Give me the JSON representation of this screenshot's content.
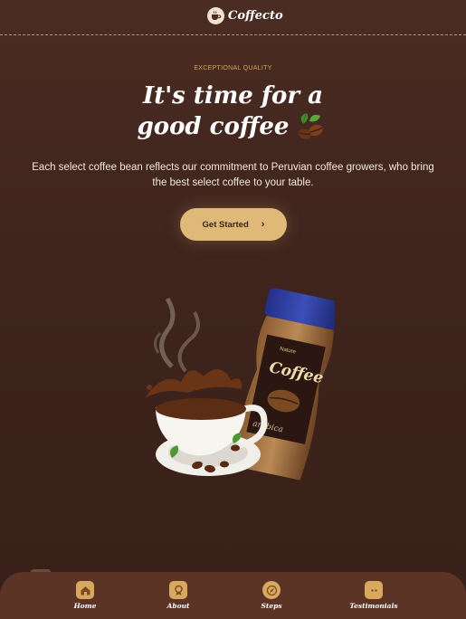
{
  "header": {
    "brand": "Coffecto",
    "logo_icon": "coffee-cup-icon"
  },
  "hero": {
    "eyebrow": "EXCEPTIONAL QUALITY",
    "headline_line1": "It's time for a",
    "headline_line2": "good coffee",
    "description": "Each select coffee bean reflects our commitment to Peruvian coffee growers, who bring the best select coffee to your table.",
    "cta_label": "Get Started",
    "cta_icon": "chevron-right-icon"
  },
  "product_jar": {
    "brand": "Nature",
    "name": "Coffee",
    "variant": "arabica"
  },
  "nav": {
    "items": [
      {
        "label": "Home",
        "icon": "home-icon"
      },
      {
        "label": "About",
        "icon": "award-icon"
      },
      {
        "label": "Steps",
        "icon": "compass-icon"
      },
      {
        "label": "Testimonials",
        "icon": "chat-icon"
      }
    ]
  },
  "colors": {
    "background": "#4a2c22",
    "accent": "#dfb978",
    "eyebrow": "#d8a45f",
    "nav": "#5c3426"
  }
}
